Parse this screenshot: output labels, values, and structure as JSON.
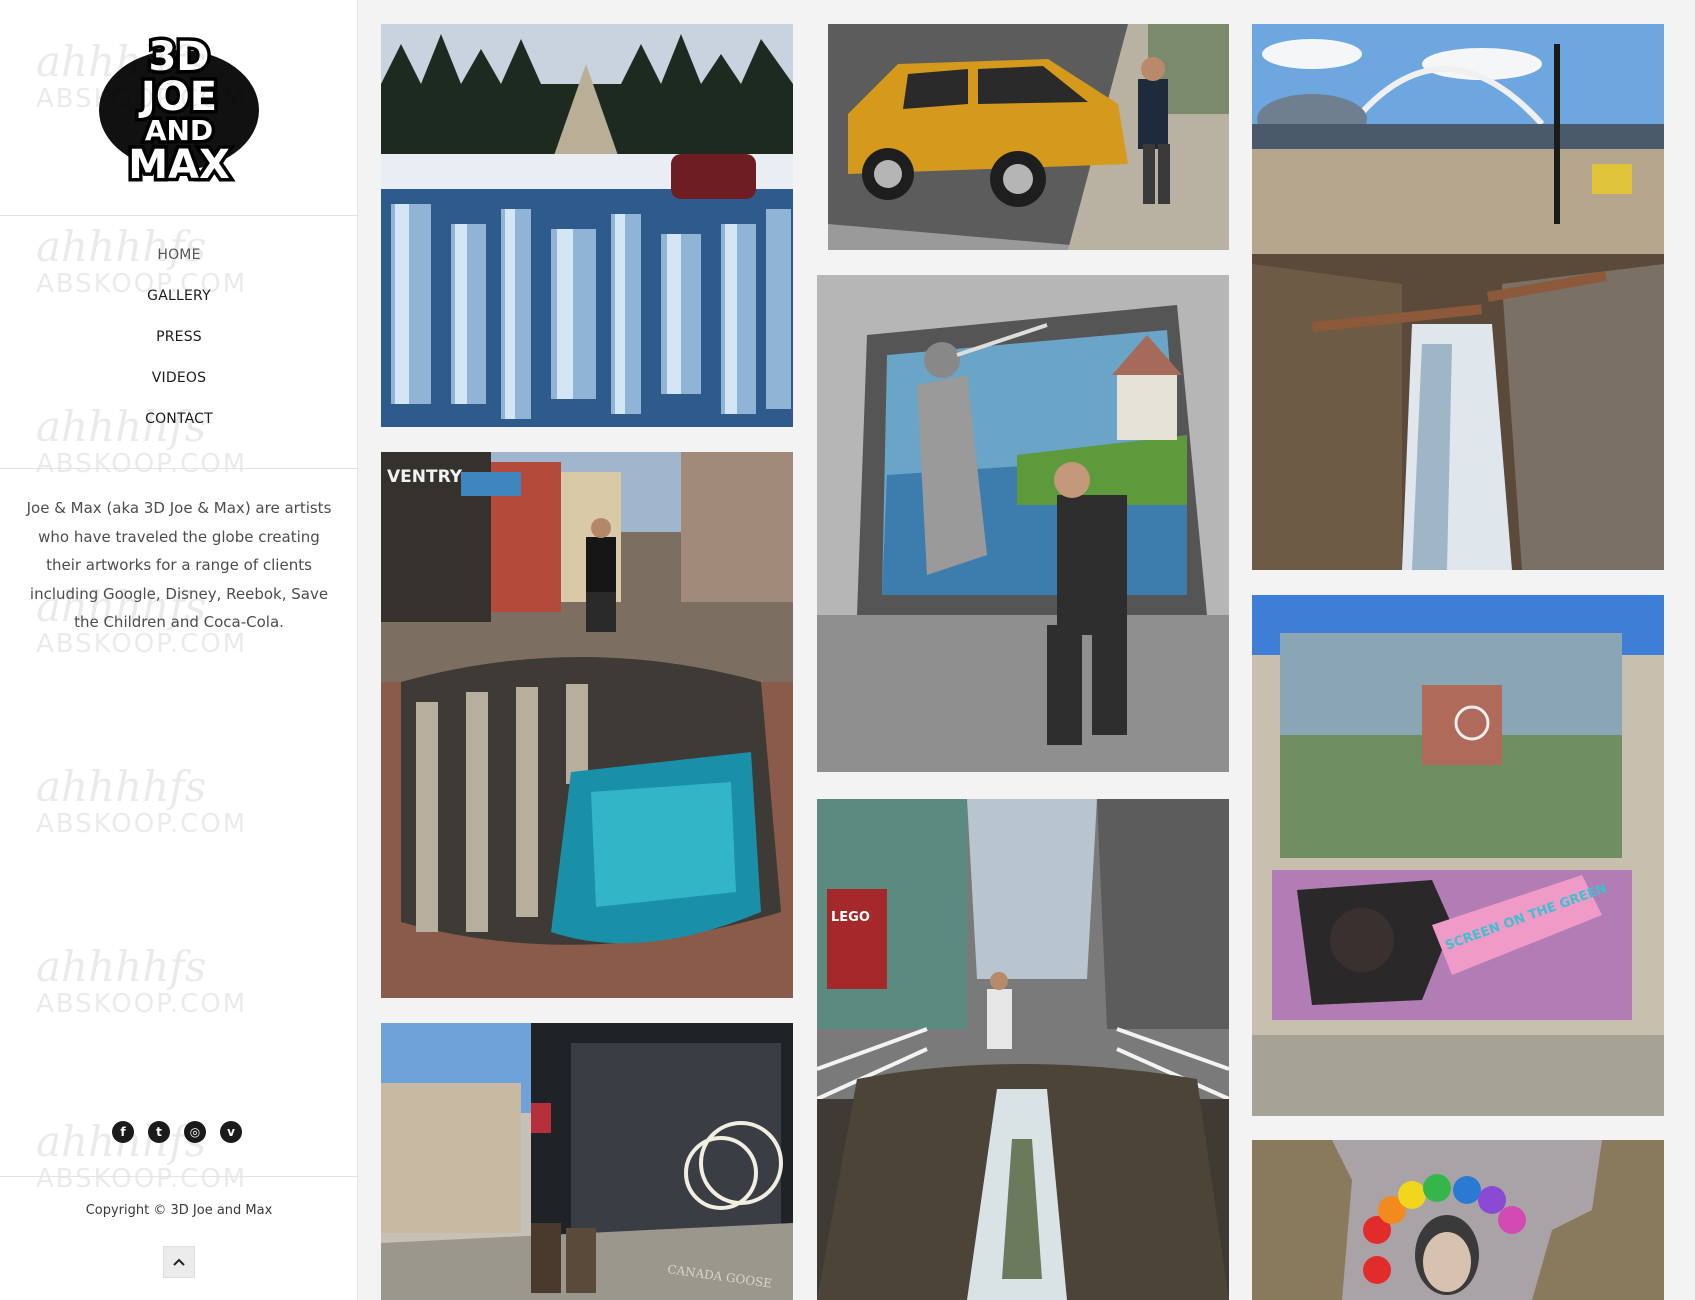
{
  "site": {
    "logo_lines": [
      "3D",
      "JOE",
      "AND",
      "MAX"
    ]
  },
  "nav": {
    "items": [
      {
        "label": "HOME"
      },
      {
        "label": "GALLERY"
      },
      {
        "label": "PRESS"
      },
      {
        "label": "VIDEOS"
      },
      {
        "label": "CONTACT"
      }
    ]
  },
  "about": {
    "text": "Joe & Max (aka 3D Joe & Max) are artists who have traveled the globe creating their artworks for a range of clients including Google, Disney, Reebok, Save the Children and Coca-Cola."
  },
  "social": [
    {
      "icon": "facebook-icon",
      "glyph": "f"
    },
    {
      "icon": "twitter-icon",
      "glyph": "t"
    },
    {
      "icon": "instagram-icon",
      "glyph": "◎"
    },
    {
      "icon": "vimeo-icon",
      "glyph": "v"
    }
  ],
  "footer": {
    "copyright": "Copyright © 3D Joe and Max",
    "scroll_top_icon": "chevron-up-icon"
  },
  "watermark": {
    "line1": "ahhhhfs",
    "line2": "ABSKOOP.COM"
  },
  "gallery": {
    "tiles": [
      {
        "name": "ice-canyon-artwork",
        "text": ""
      },
      {
        "name": "yellow-suv-artwork",
        "text": ""
      },
      {
        "name": "bridge-waterfall-artwork",
        "text": ""
      },
      {
        "name": "knight-wall-artwork",
        "text": ""
      },
      {
        "name": "street-pool-artwork",
        "text": "VENTRY"
      },
      {
        "name": "kong-screen-artwork",
        "text": "SCREEN ON THE GREEN"
      },
      {
        "name": "crocodile-canyon-artwork",
        "text": "LEGO"
      },
      {
        "name": "shopfront-artwork",
        "text": "CANADA GOOSE"
      },
      {
        "name": "rainbow-portrait-artwork",
        "text": ""
      }
    ]
  },
  "colors": {
    "page_bg": "#f3f3f3",
    "sidebar_bg": "#ffffff",
    "text": "#1c1c1c"
  }
}
